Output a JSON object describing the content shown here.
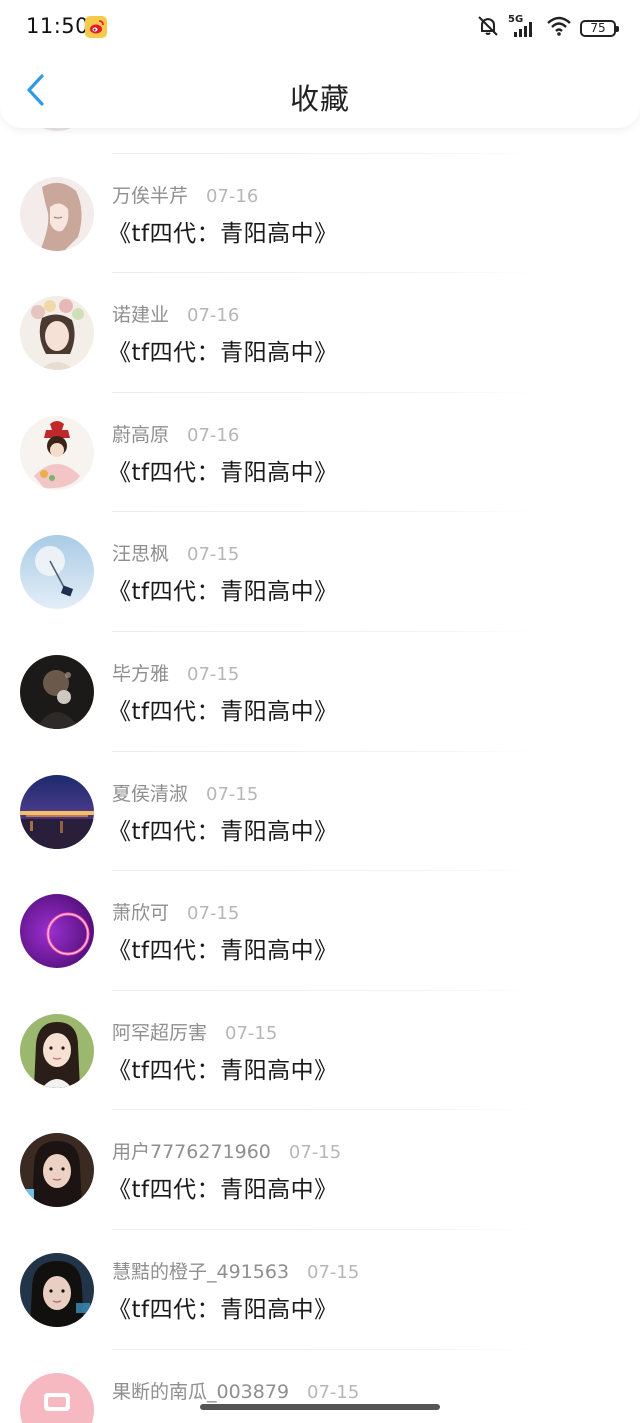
{
  "status_bar": {
    "time": "11:50",
    "network": "5G",
    "battery": "75",
    "icons": [
      "weibo-app-icon",
      "mute-icon",
      "signal-icon",
      "wifi-icon",
      "battery-icon"
    ]
  },
  "header": {
    "title": "收藏",
    "back_icon": "chevron-left-icon"
  },
  "colors": {
    "accent": "#2f9be8",
    "author_text": "#8f8f8f",
    "date_text": "#b7b7b7",
    "title_text": "#1a1a1a"
  },
  "list": [
    {
      "author": "",
      "date": "",
      "title": "",
      "avatar": "partial-avatar"
    },
    {
      "author": "万俟半芹",
      "date": "07-16",
      "title": "《tf四代：青阳高中》",
      "avatar": "anime-girl-avatar"
    },
    {
      "author": "诺建业",
      "date": "07-16",
      "title": "《tf四代：青阳高中》",
      "avatar": "flower-crown-girl-avatar"
    },
    {
      "author": "蔚高原",
      "date": "07-16",
      "title": "《tf四代：青阳高中》",
      "avatar": "cartoon-girl-avatar"
    },
    {
      "author": "汪思枫",
      "date": "07-15",
      "title": "《tf四代：青阳高中》",
      "avatar": "sky-avatar"
    },
    {
      "author": "毕方雅",
      "date": "07-15",
      "title": "《tf四代：青阳高中》",
      "avatar": "dark-photo-avatar"
    },
    {
      "author": "夏侯清淑",
      "date": "07-15",
      "title": "《tf四代：青阳高中》",
      "avatar": "night-city-avatar"
    },
    {
      "author": "萧欣可",
      "date": "07-15",
      "title": "《tf四代：青阳高中》",
      "avatar": "purple-ring-avatar"
    },
    {
      "author": "阿罕超厉害",
      "date": "07-15",
      "title": "《tf四代：青阳高中》",
      "avatar": "girl-portrait-avatar"
    },
    {
      "author": "用户7776271960",
      "date": "07-15",
      "title": "《tf四代：青阳高中》",
      "avatar": "girl-portrait-dark-avatar"
    },
    {
      "author": "慧黠的橙子_491563",
      "date": "07-15",
      "title": "《tf四代：青阳高中》",
      "avatar": "girl-portrait-blue-avatar"
    },
    {
      "author": "果断的南瓜_003879",
      "date": "07-15",
      "title": "",
      "avatar": "pink-avatar"
    }
  ]
}
